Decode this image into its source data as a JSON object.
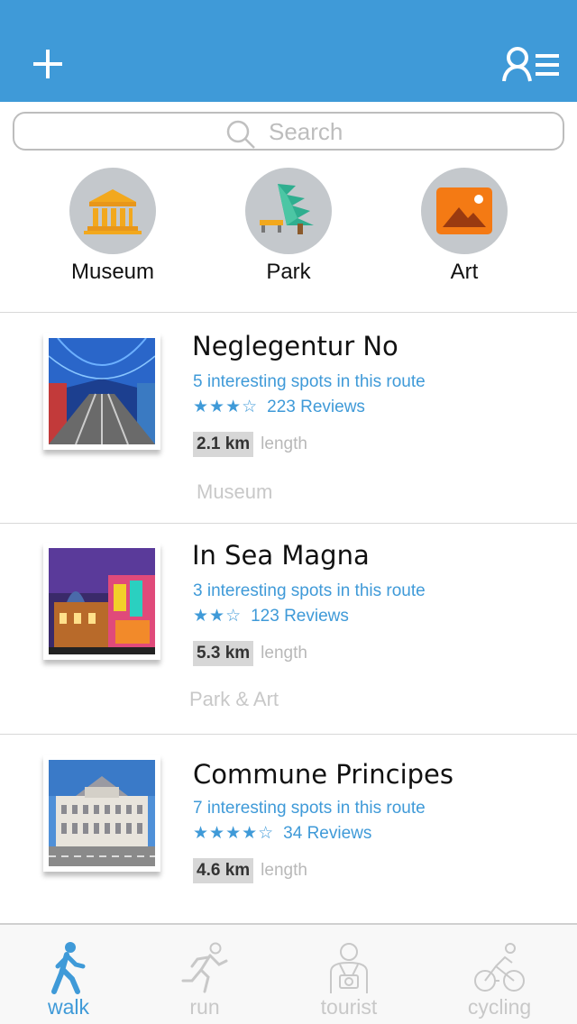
{
  "header": {
    "add_icon": "plus-icon",
    "profile_icon": "user-list-icon",
    "color": "#3f9ad8"
  },
  "search": {
    "placeholder": "Search",
    "icon": "search-icon"
  },
  "categories": [
    {
      "label": "Museum",
      "icon": "museum-icon"
    },
    {
      "label": "Park",
      "icon": "park-icon"
    },
    {
      "label": "Art",
      "icon": "art-icon"
    }
  ],
  "routes": [
    {
      "title": "Neglegentur No",
      "spots": "5 interesting spots in this route",
      "stars": "★★★☆",
      "reviews": "223 Reviews",
      "length": "2.1 km",
      "length_label": "length",
      "category": "Museum"
    },
    {
      "title": "In Sea Magna",
      "spots": "3 interesting spots in this route",
      "stars": "★★☆",
      "reviews": "123 Reviews",
      "length": "5.3 km",
      "length_label": "length",
      "category": "Park & Art"
    },
    {
      "title": "Commune Principes",
      "spots": "7 interesting spots in this route",
      "stars": "★★★★☆",
      "reviews": "34 Reviews",
      "length": "4.6 km",
      "length_label": "length",
      "category": ""
    }
  ],
  "tabs": [
    {
      "label": "walk",
      "icon": "walk-icon",
      "active": true
    },
    {
      "label": "run",
      "icon": "run-icon",
      "active": false
    },
    {
      "label": "tourist",
      "icon": "tourist-icon",
      "active": false
    },
    {
      "label": "cycling",
      "icon": "cycling-icon",
      "active": false
    }
  ],
  "colors": {
    "accent": "#3f9ad8",
    "muted": "#c8c8c8"
  }
}
